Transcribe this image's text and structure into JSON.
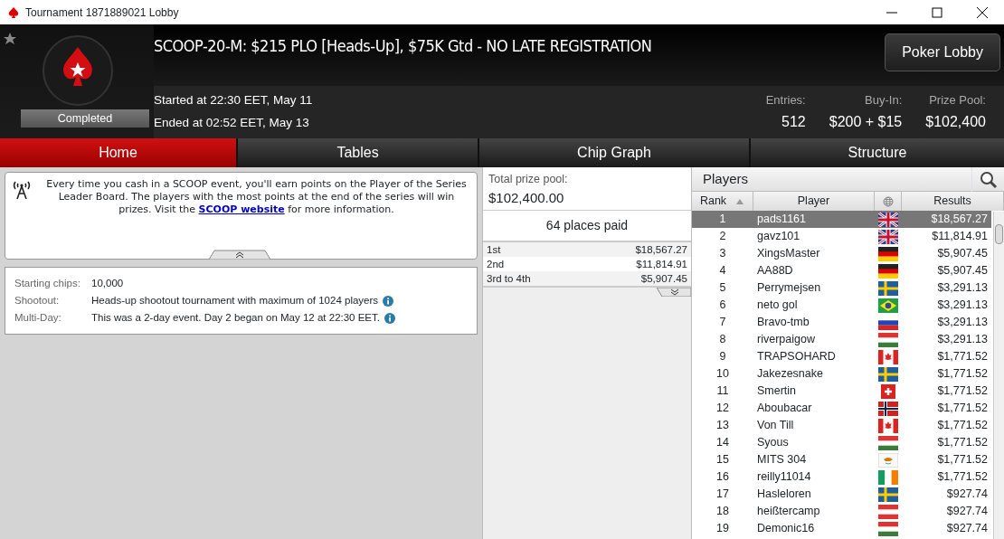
{
  "window": {
    "title": "Tournament 1871889021 Lobby"
  },
  "header": {
    "title": "SCOOP-20-M: $215 PLO [Heads-Up], $75K Gtd - NO LATE REGISTRATION",
    "favorite": false,
    "status": "Completed",
    "started": "Started at 22:30 EET, May 11",
    "ended": "Ended at 02:52 EET, May 13",
    "lobby_button": "Poker Lobby",
    "stats": [
      {
        "label": "Entries:",
        "value": "512"
      },
      {
        "label": "Buy-In:",
        "value": "$200 + $15"
      },
      {
        "label": "Prize Pool:",
        "value": "$102,400"
      }
    ]
  },
  "tabs": [
    {
      "label": "Home",
      "selected": true
    },
    {
      "label": "Tables",
      "selected": false
    },
    {
      "label": "Chip Graph",
      "selected": false
    },
    {
      "label": "Structure",
      "selected": false
    }
  ],
  "news": {
    "text": "Every time you cash in a SCOOP event, you'll earn points on the Player of the Series Leader Board. The players with the most points at the end of the series will win prizes.",
    "before_link": "Visit the",
    "link": "SCOOP website",
    "after_link": "for more information."
  },
  "details": [
    {
      "label": "Starting chips:",
      "value": "10,000",
      "info": false
    },
    {
      "label": "Shootout:",
      "value": "Heads-up shootout tournament with maximum of 1024 players",
      "info": true
    },
    {
      "label": "Multi-Day:",
      "value": "This was a 2-day event. Day 2 began on May 12 at 22:30 EET.",
      "info": true
    }
  ],
  "prizes": {
    "label": "Total prize pool:",
    "total": "$102,400.00",
    "places": "64 places paid",
    "rows": [
      {
        "place": "1st",
        "amount": "$18,567.27"
      },
      {
        "place": "2nd",
        "amount": "$11,814.91"
      },
      {
        "place": "3rd to 4th",
        "amount": "$5,907.45"
      }
    ]
  },
  "players": {
    "title": "Players",
    "columns": [
      "Rank",
      "Player",
      "Results"
    ],
    "rows": [
      {
        "rank": "1",
        "name": "pads1161",
        "kind": "gb",
        "result": "$18,567.27",
        "selected": true
      },
      {
        "rank": "2",
        "name": "gavz101",
        "kind": "gb",
        "result": "$11,814.91",
        "selected": false
      },
      {
        "rank": "3",
        "name": "XingsMaster",
        "kind": "de",
        "result": "$5,907.45",
        "selected": false
      },
      {
        "rank": "4",
        "name": "AA88D",
        "kind": "de",
        "result": "$5,907.45",
        "selected": false
      },
      {
        "rank": "5",
        "name": "Perrymejsen",
        "kind": "se",
        "result": "$3,291.13",
        "selected": false
      },
      {
        "rank": "6",
        "name": "neto gol",
        "kind": "br",
        "result": "$3,291.13",
        "selected": false
      },
      {
        "rank": "7",
        "name": "Bravo-tmb",
        "kind": "ru",
        "result": "$3,291.13",
        "selected": false
      },
      {
        "rank": "8",
        "name": "riverpaigow",
        "kind": "hu",
        "result": "$3,291.13",
        "selected": false
      },
      {
        "rank": "9",
        "name": "TRAPSOHARD",
        "kind": "ca",
        "result": "$1,771.52",
        "selected": false
      },
      {
        "rank": "10",
        "name": "Jakezesnake",
        "kind": "se",
        "result": "$1,771.52",
        "selected": false
      },
      {
        "rank": "11",
        "name": "Smertin",
        "kind": "ch",
        "result": "$1,771.52",
        "selected": false
      },
      {
        "rank": "12",
        "name": "Aboubacar",
        "kind": "no",
        "result": "$1,771.52",
        "selected": false
      },
      {
        "rank": "13",
        "name": "Von Till",
        "kind": "ca",
        "result": "$1,771.52",
        "selected": false
      },
      {
        "rank": "14",
        "name": "Syous",
        "kind": "hu",
        "result": "$1,771.52",
        "selected": false
      },
      {
        "rank": "15",
        "name": "MITS 304",
        "kind": "cy",
        "result": "$1,771.52",
        "selected": false
      },
      {
        "rank": "16",
        "name": "reilly11014",
        "kind": "ie",
        "result": "$1,771.52",
        "selected": false
      },
      {
        "rank": "17",
        "name": "Hasleloren",
        "kind": "se",
        "result": "$927.74",
        "selected": false
      },
      {
        "rank": "18",
        "name": "heißtercamp",
        "kind": "at",
        "result": "$927.74",
        "selected": false
      },
      {
        "rank": "19",
        "name": "Demonic16",
        "kind": "hu",
        "result": "$927.74",
        "selected": false
      }
    ]
  }
}
